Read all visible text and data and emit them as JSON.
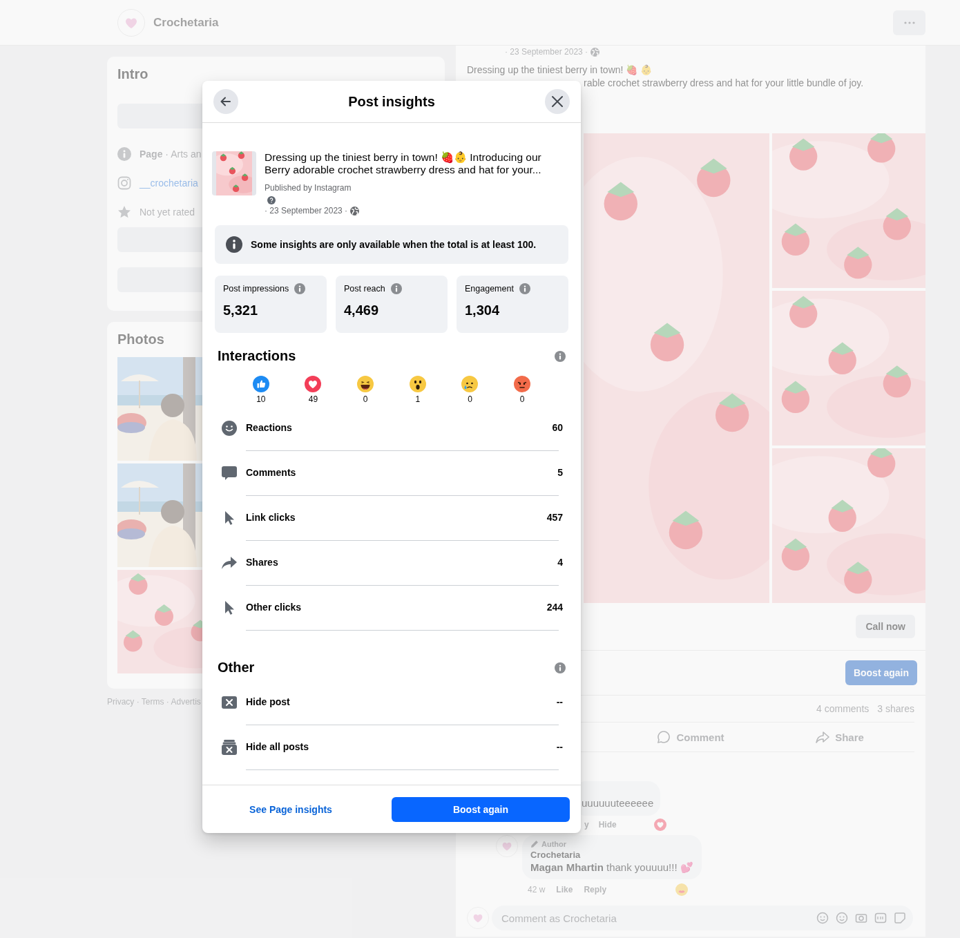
{
  "header": {
    "page_name": "Crochetaria"
  },
  "intro": {
    "title": "Intro",
    "rows": [
      {
        "kind": "category",
        "text": "**Page** · Arts an"
      },
      {
        "kind": "instagram",
        "text": "__crochetaria"
      },
      {
        "kind": "rating",
        "text": "Not yet rated"
      }
    ]
  },
  "photos": {
    "title": "Photos"
  },
  "footer_links": "Privacy · Terms · Advertis",
  "post": {
    "date": "· 23 September 2023 ·",
    "text_line_1": "Dressing up the tiniest berry in town! 🍓 👶",
    "text_line_2": "rable crochet strawberry dress and hat for your little bundle of joy.",
    "call_button": "Call now",
    "boost_button": "Boost again",
    "comments_count": "4 comments",
    "shares_count": "3 shares",
    "actions": [
      {
        "kind": "comment",
        "label": "Comment"
      },
      {
        "kind": "share",
        "label": "Share"
      }
    ],
    "comment": {
      "text": "uuuuuuteeeeee",
      "actions": [
        "y",
        "Hide"
      ]
    },
    "reply": {
      "badge": "Author",
      "name": "Crochetaria",
      "text": "**Magan Mhartin** thank youuuu!!! 💕",
      "time": "42 w",
      "actions": [
        "Like",
        "Reply"
      ]
    },
    "composer": {
      "placeholder": "Comment as Crochetaria"
    }
  },
  "modal": {
    "title": "Post insights",
    "post": {
      "caption": "Dressing up the tiniest berry in town! 🍓👶 Introducing our Berry adorable crochet strawberry dress and hat for your...",
      "published_by": "Published by Instagram",
      "date": "· 23 September 2023 ·"
    },
    "notice": "Some insights are only available when the total is at least 100.",
    "stats": [
      {
        "label": "Post impressions",
        "value": "5,321"
      },
      {
        "label": "Post reach",
        "value": "4,469"
      },
      {
        "label": "Engagement",
        "value": "1,304"
      }
    ],
    "interactions": {
      "title": "Interactions",
      "reactions": [
        {
          "kind": "like",
          "count": "10"
        },
        {
          "kind": "love",
          "count": "49"
        },
        {
          "kind": "haha",
          "count": "0"
        },
        {
          "kind": "wow",
          "count": "1"
        },
        {
          "kind": "sad",
          "count": "0"
        },
        {
          "kind": "angry",
          "count": "0"
        }
      ],
      "metrics": [
        {
          "kind": "reactions",
          "label": "Reactions",
          "value": "60"
        },
        {
          "kind": "comments",
          "label": "Comments",
          "value": "5"
        },
        {
          "kind": "clicks",
          "label": "Link clicks",
          "value": "457"
        },
        {
          "kind": "shares",
          "label": "Shares",
          "value": "4"
        },
        {
          "kind": "clicks",
          "label": "Other clicks",
          "value": "244"
        }
      ]
    },
    "other": {
      "title": "Other",
      "metrics": [
        {
          "kind": "hide",
          "label": "Hide post",
          "value": "--"
        },
        {
          "kind": "hide_all",
          "label": "Hide all posts",
          "value": "--"
        }
      ]
    },
    "footer": {
      "link": "See Page insights",
      "button": "Boost again"
    }
  }
}
